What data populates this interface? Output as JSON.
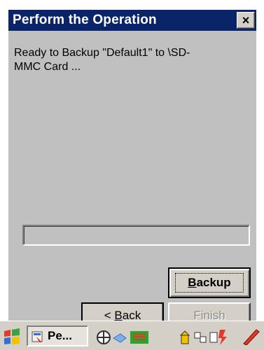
{
  "window": {
    "title": "Perform the Operation",
    "close_label": "×"
  },
  "message": "Ready to Backup \"Default1\" to \\SD-\nMMC Card ...",
  "progress": {
    "value": 0
  },
  "buttons": {
    "backup_label_pre": "",
    "backup_label_mnemonic": "B",
    "backup_label_post": "ackup",
    "back_label_pre": "< ",
    "back_label_mnemonic": "B",
    "back_label_post": "ack",
    "finish_label": "Finish"
  },
  "taskbar": {
    "task_label": "Pe..."
  },
  "colors": {
    "title_bar": "#0a246a",
    "window_bg": "#c0c0c0",
    "disabled_text": "#8a8a8a"
  }
}
